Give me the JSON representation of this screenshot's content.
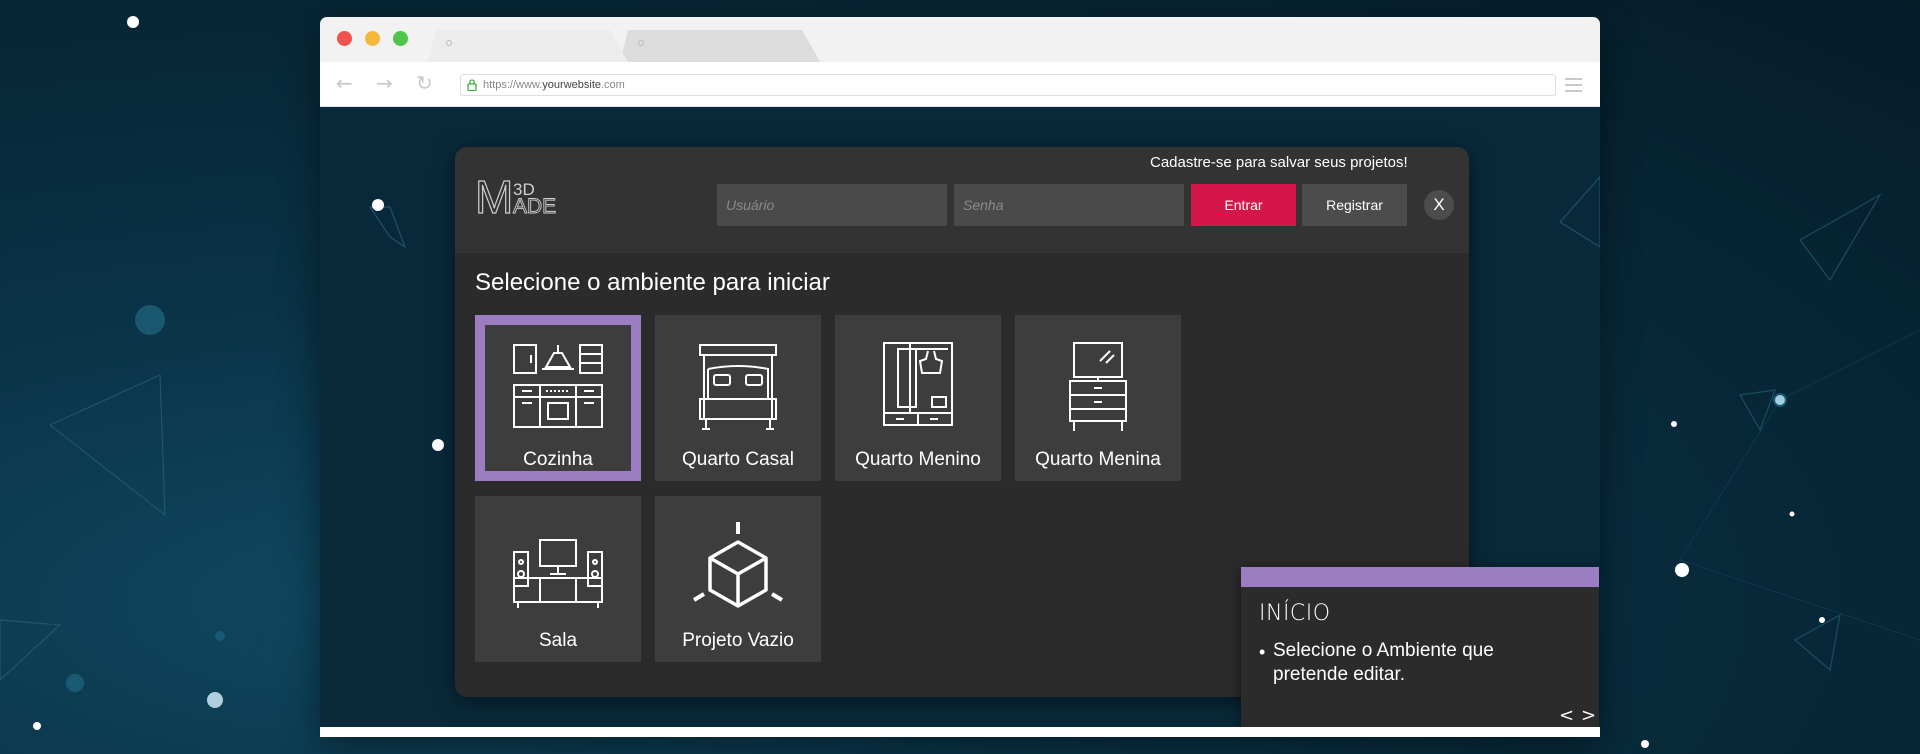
{
  "browser": {
    "url_prefix": "https://www.",
    "url_domain": "yourwebsite",
    "url_suffix": ".com",
    "back_glyph": "←",
    "forward_glyph": "→",
    "reload_glyph": "↻"
  },
  "header": {
    "logo_superscript": "3D",
    "logo_letter": "M",
    "logo_rest": "ADE",
    "signup_note": "Cadastre-se para salvar seus projetos!",
    "username_placeholder": "Usuário",
    "password_placeholder": "Senha",
    "login_label": "Entrar",
    "register_label": "Registrar",
    "close_label": "X"
  },
  "main": {
    "title": "Selecione o ambiente para iniciar",
    "rooms": [
      {
        "label": "Cozinha",
        "icon": "kitchen-icon",
        "selected": true
      },
      {
        "label": "Quarto Casal",
        "icon": "double-bed-icon"
      },
      {
        "label": "Quarto Menino",
        "icon": "wardrobe-icon"
      },
      {
        "label": "Quarto Menina",
        "icon": "dresser-mirror-icon"
      },
      {
        "label": "Sala",
        "icon": "tv-stand-icon"
      },
      {
        "label": "Projeto Vazio",
        "icon": "empty-cube-icon"
      }
    ]
  },
  "tip": {
    "title": "INÍCIO",
    "bullet": "•",
    "text": "Selecione o Ambiente que pretende editar.",
    "prev": "<",
    "next": ">"
  },
  "colors": {
    "accent_purple": "#9b7ec2",
    "login_red": "#d4164a",
    "panel_bg": "#2b2b2b",
    "card_bg": "#3d3d3d"
  }
}
